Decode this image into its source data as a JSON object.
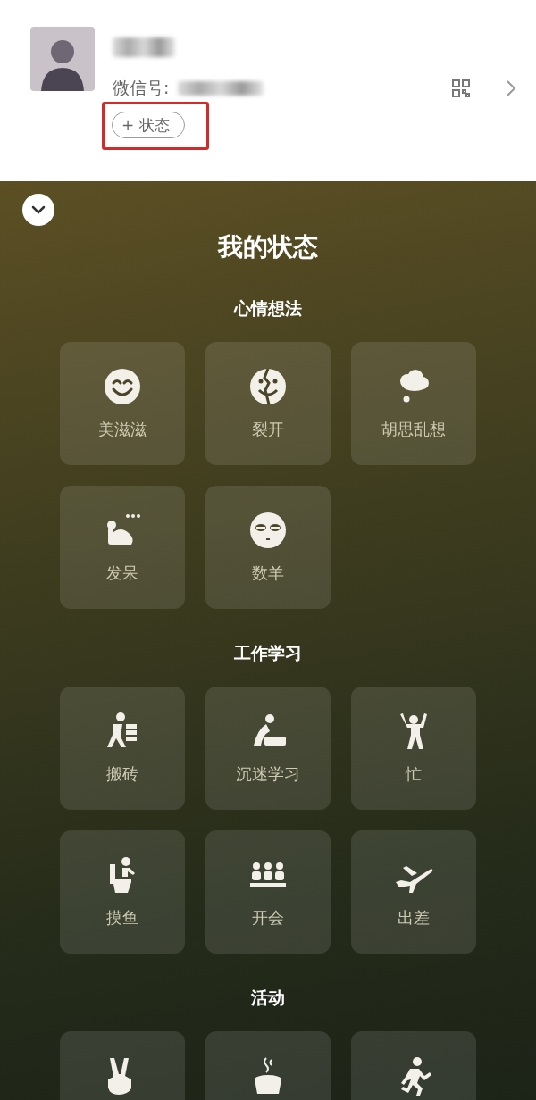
{
  "profile": {
    "wechat_id_label": "微信号:",
    "status_button": {
      "plus": "+",
      "label": "状态"
    },
    "highlighted": true
  },
  "panel": {
    "title": "我的状态",
    "sections": [
      {
        "heading": "心情想法",
        "items": [
          {
            "kind": "smile",
            "label": "美滋滋"
          },
          {
            "kind": "cracked",
            "label": "裂开"
          },
          {
            "kind": "cloud",
            "label": "胡思乱想"
          },
          {
            "kind": "daze",
            "label": "发呆"
          },
          {
            "kind": "sleepy",
            "label": "数羊"
          }
        ]
      },
      {
        "heading": "工作学习",
        "items": [
          {
            "kind": "bricks",
            "label": "搬砖"
          },
          {
            "kind": "study",
            "label": "沉迷学习"
          },
          {
            "kind": "busy",
            "label": "忙"
          },
          {
            "kind": "slack",
            "label": "摸鱼"
          },
          {
            "kind": "meeting",
            "label": "开会"
          },
          {
            "kind": "plane",
            "label": "出差"
          }
        ]
      },
      {
        "heading": "活动",
        "items": [
          {
            "kind": "victory"
          },
          {
            "kind": "coffee"
          },
          {
            "kind": "running"
          }
        ]
      }
    ]
  }
}
